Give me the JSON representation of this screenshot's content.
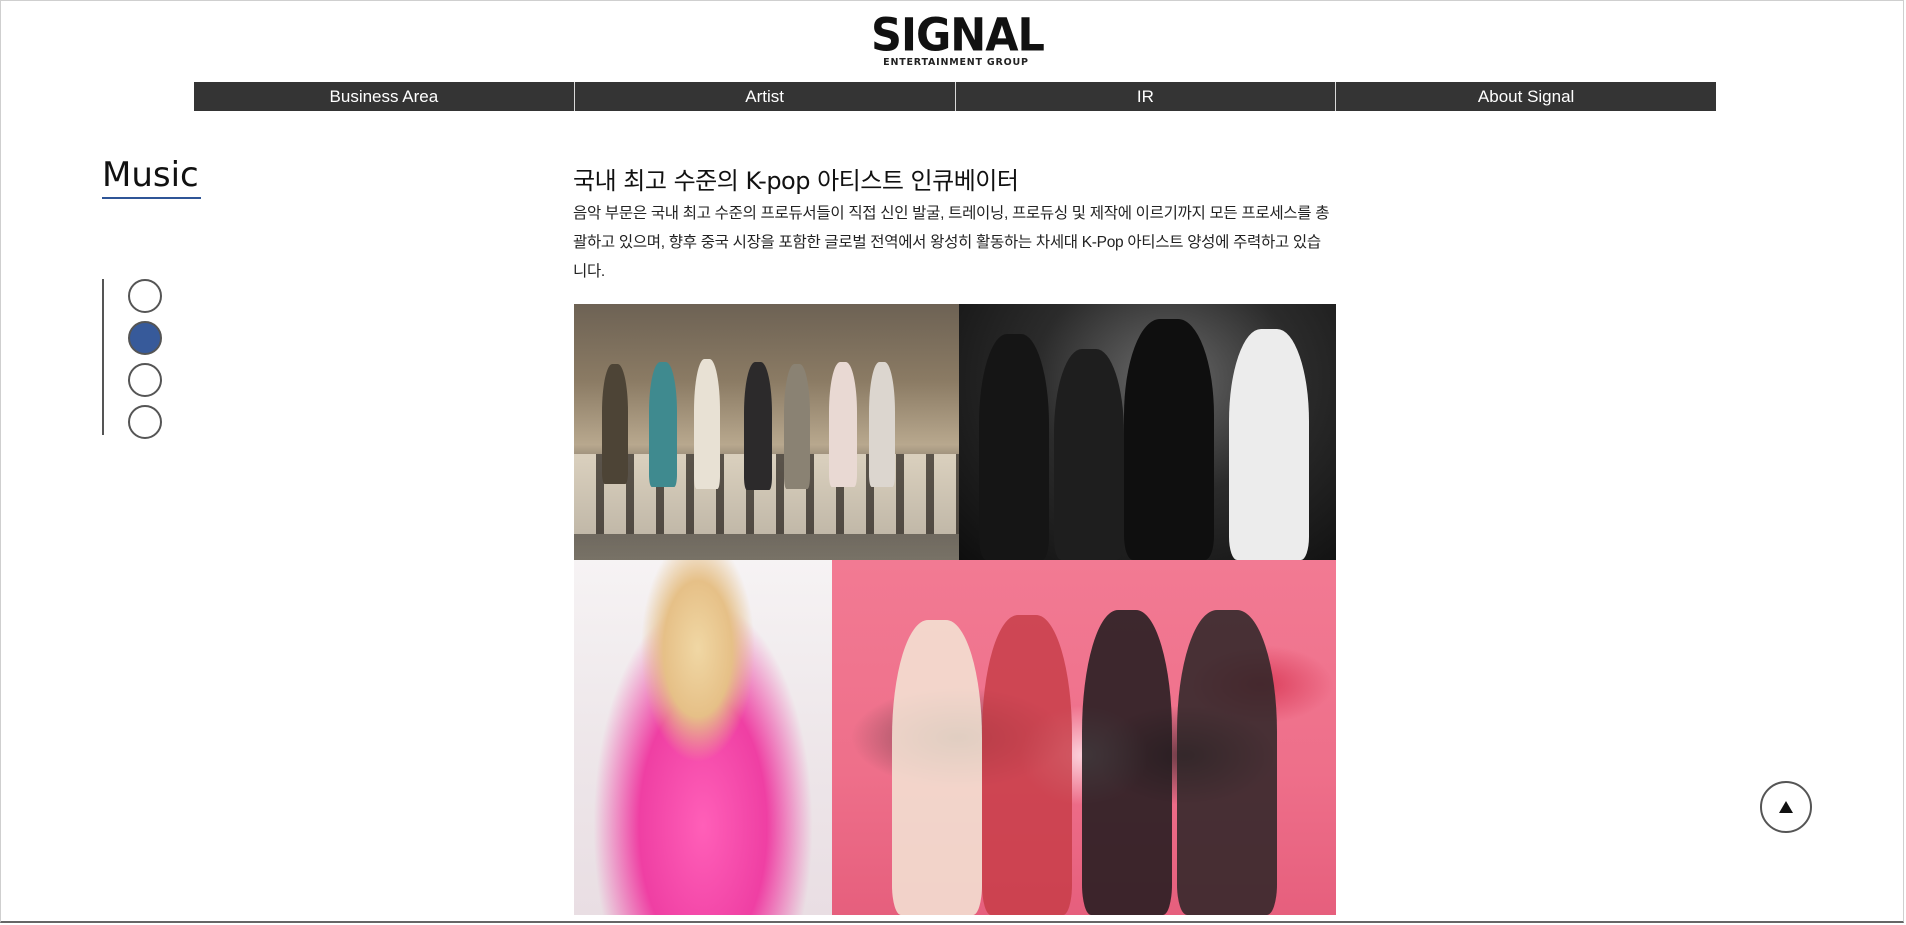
{
  "logo": {
    "wordmark": "SIGNAL",
    "tagline": "ENTERTAINMENT GROUP"
  },
  "nav": {
    "items": [
      {
        "label": "Business Area"
      },
      {
        "label": "Artist"
      },
      {
        "label": "IR"
      },
      {
        "label": "About Signal"
      }
    ]
  },
  "sidebar": {
    "section_title": "Music",
    "indicator": {
      "count": 4,
      "active_index": 1
    }
  },
  "main": {
    "headline": "국내 최고 수준의 K-pop 아티스트 인큐베이터",
    "description": "음악 부문은 국내 최고 수준의 프로듀서들이 직접 신인 발굴, 트레이닝, 프로듀싱 및 제작에 이르기까지 모든 프로세스를 총괄하고 있으며, 향후 중국 시장을 포함한 글로벌 전역에서 왕성히 활동하는 차세대 K-Pop 아티스트 양성에 주력하고 있습니다."
  },
  "gallery": {
    "photos": [
      {
        "name": "group-crosswalk-photo"
      },
      {
        "name": "group-black-suits-photo"
      },
      {
        "name": "solo-pink-shirt-photo"
      },
      {
        "name": "girl-group-pink-background-photo"
      }
    ]
  },
  "colors": {
    "nav_bg": "#343434",
    "accent": "#2f5597",
    "active_dot": "#375a9a"
  },
  "icons": {
    "scroll_top": "triangle-up-icon"
  }
}
